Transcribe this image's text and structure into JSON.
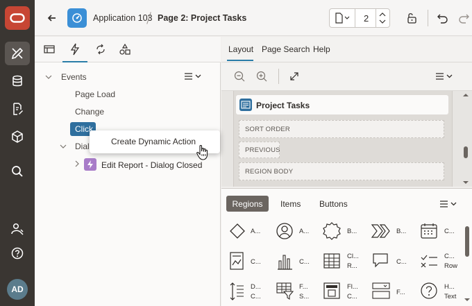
{
  "app": {
    "name": "Application 103",
    "page": "Page 2: Project Tasks",
    "page_number": "2"
  },
  "rail": {
    "avatar": "AD"
  },
  "left_tabs": [
    "rendering-icon",
    "dynamic-actions-icon",
    "processing-icon",
    "shared-components-icon"
  ],
  "tree": {
    "events_label": "Events",
    "items": [
      "Page Load",
      "Change",
      "Click"
    ],
    "dialog_label": "Dialo",
    "dialog_child": "Edit Report - Dialog Closed"
  },
  "context_menu": {
    "item": "Create Dynamic Action"
  },
  "middle_tabs": {
    "layout": "Layout",
    "page_search": "Page Search",
    "help": "Help"
  },
  "canvas": {
    "region_title": "Project Tasks",
    "slots": [
      "SORT ORDER",
      "PREVIOUS",
      "REGION BODY"
    ]
  },
  "gallery": {
    "tabs": [
      "Regions",
      "Items",
      "Buttons"
    ],
    "row1": [
      "A...",
      "A...",
      "B...",
      "B...",
      "C..."
    ],
    "row2": [
      [
        "C..."
      ],
      [
        "C..."
      ],
      [
        "Cl...",
        "R..."
      ],
      [
        "C..."
      ],
      [
        "C...",
        "Row"
      ]
    ],
    "row3": [
      [
        "D...",
        "C..."
      ],
      [
        "F...",
        "S..."
      ],
      [
        "Fl...",
        "C..."
      ],
      [
        "F..."
      ],
      [
        "H...",
        "Text"
      ]
    ]
  },
  "colors": {
    "rail_bg": "#3a3632",
    "oracle_red": "#c74634",
    "click_blue": "#2f6f9e",
    "app_icon": "#3b8fd6",
    "tab_underline": "#2a7da8"
  }
}
